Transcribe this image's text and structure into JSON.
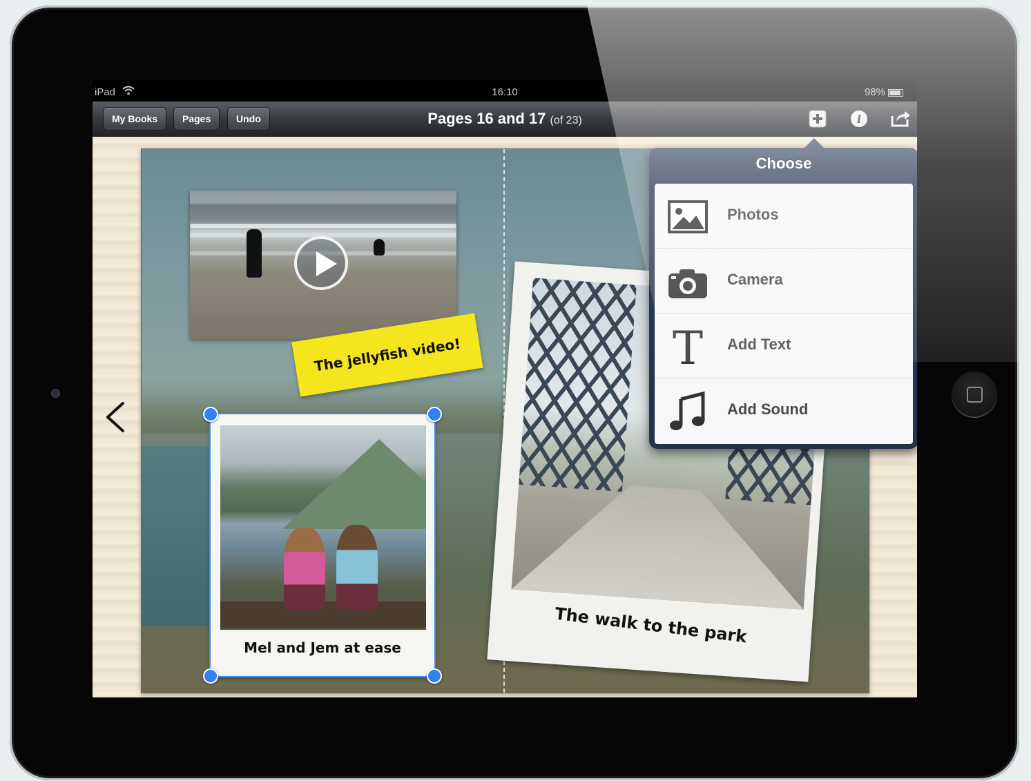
{
  "status_bar": {
    "device": "iPad",
    "time": "16:10",
    "battery": "98%"
  },
  "toolbar": {
    "buttons": [
      {
        "label": "My Books"
      },
      {
        "label": "Pages"
      },
      {
        "label": "Undo"
      }
    ],
    "title": "Pages 16 and 17",
    "title_suffix": "(of 23)",
    "icons": [
      "add-icon",
      "info-icon",
      "share-icon"
    ]
  },
  "book": {
    "sticky_note": "The jellyfish video!",
    "photo_kids_caption": "Mel and Jem at ease",
    "photo_bridge_caption": "The walk to the park"
  },
  "popover": {
    "title": "Choose",
    "items": [
      {
        "label": "Photos",
        "icon": "photo-icon"
      },
      {
        "label": "Camera",
        "icon": "camera-icon"
      },
      {
        "label": "Add Text",
        "icon": "text-icon"
      },
      {
        "label": "Add Sound",
        "icon": "music-note-icon"
      }
    ]
  },
  "colors": {
    "selection": "#2f82ef",
    "sticky": "#f5e51d",
    "popover_header": "#2f3c55"
  }
}
